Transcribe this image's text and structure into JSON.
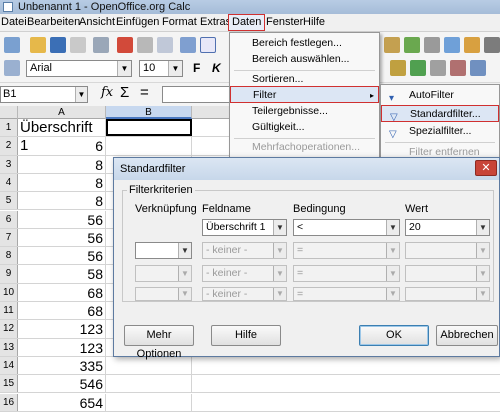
{
  "window": {
    "title": "Unbenannt 1 - OpenOffice.org Calc"
  },
  "menubar": {
    "items": [
      {
        "label": "Datei",
        "active": false
      },
      {
        "label": "Bearbeiten",
        "active": false
      },
      {
        "label": "Ansicht",
        "active": false
      },
      {
        "label": "Einfügen",
        "active": false
      },
      {
        "label": "Format",
        "active": false
      },
      {
        "label": "Extras",
        "active": false
      },
      {
        "label": "Daten",
        "active": true
      },
      {
        "label": "Fenster",
        "active": false
      },
      {
        "label": "Hilfe",
        "active": false
      }
    ]
  },
  "toolbar": {
    "font_name": "Arial",
    "font_size": "10",
    "bold_label": "F",
    "italic_label": "K"
  },
  "formula_bar": {
    "cell_ref": "B1",
    "func_icon": "fx",
    "sum_icon": "Σ",
    "equals_icon": "="
  },
  "grid": {
    "columns": [
      "A",
      "B"
    ],
    "selected_column": "B",
    "rows": [
      {
        "num": "1",
        "a": "Überschrift 1"
      },
      {
        "num": "2",
        "a": "6"
      },
      {
        "num": "3",
        "a": "8"
      },
      {
        "num": "4",
        "a": "8"
      },
      {
        "num": "5",
        "a": "8"
      },
      {
        "num": "6",
        "a": "56"
      },
      {
        "num": "7",
        "a": "56"
      },
      {
        "num": "8",
        "a": "56"
      },
      {
        "num": "9",
        "a": "58"
      },
      {
        "num": "10",
        "a": "68"
      },
      {
        "num": "11",
        "a": "68"
      },
      {
        "num": "12",
        "a": "123"
      },
      {
        "num": "13",
        "a": "123"
      },
      {
        "num": "14",
        "a": "335"
      },
      {
        "num": "15",
        "a": "546"
      },
      {
        "num": "16",
        "a": "654"
      }
    ]
  },
  "daten_menu": {
    "items": [
      {
        "label": "Bereich festlegen...",
        "state": "normal"
      },
      {
        "label": "Bereich auswählen...",
        "state": "normal"
      },
      {
        "label": "Sortieren...",
        "state": "normal"
      },
      {
        "label": "Filter",
        "state": "highlight",
        "submenu": "▸"
      },
      {
        "label": "Teilergebnisse...",
        "state": "normal"
      },
      {
        "label": "Gültigkeit...",
        "state": "normal"
      },
      {
        "label": "Mehrfachoperationen...",
        "state": "disabled"
      }
    ]
  },
  "filter_submenu": {
    "items": [
      {
        "label": "AutoFilter",
        "state": "normal",
        "icon": "autofilter-icon"
      },
      {
        "label": "Standardfilter...",
        "state": "highlight",
        "icon": "funnel-icon"
      },
      {
        "label": "Spezialfilter...",
        "state": "normal",
        "icon": "special-filter-icon"
      },
      {
        "label": "Filter entfernen",
        "state": "disabled",
        "icon": ""
      }
    ]
  },
  "dialog": {
    "title": "Standardfilter",
    "group_label": "Filterkriterien",
    "headers": {
      "link": "Verknüpfung",
      "field": "Feldname",
      "condition": "Bedingung",
      "value": "Wert"
    },
    "rows": [
      {
        "link": "",
        "field": "Überschrift 1",
        "condition": "<",
        "value": "20",
        "enabled": true
      },
      {
        "link": "",
        "field": "- keiner -",
        "condition": "=",
        "value": "",
        "enabled": false
      },
      {
        "link": "",
        "field": "- keiner -",
        "condition": "=",
        "value": "",
        "enabled": false
      },
      {
        "link": "",
        "field": "- keiner -",
        "condition": "=",
        "value": "",
        "enabled": false
      }
    ],
    "buttons": {
      "more": "Mehr Optionen",
      "help": "Hilfe",
      "ok": "OK",
      "cancel": "Abbrechen"
    }
  }
}
